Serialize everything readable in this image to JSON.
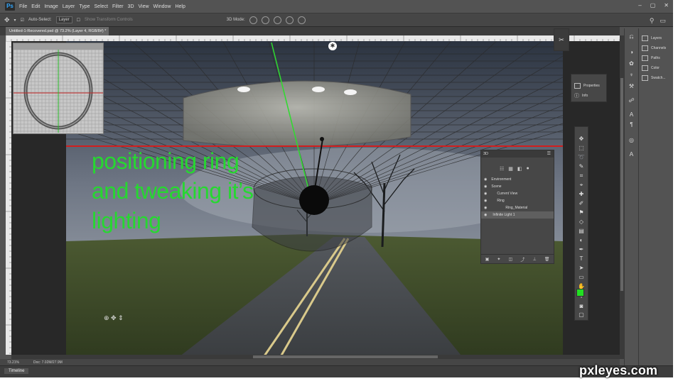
{
  "app": {
    "logo": "Ps"
  },
  "menu": [
    "File",
    "Edit",
    "Image",
    "Layer",
    "Type",
    "Select",
    "Filter",
    "3D",
    "View",
    "Window",
    "Help"
  ],
  "window_controls": {
    "minimize": "–",
    "restore": "▢",
    "close": "✕"
  },
  "options_bar": {
    "move_icon": "✥",
    "auto_select_label": "Auto-Select:",
    "auto_select_target": "Layer",
    "show_transform": "Show Transform Controls",
    "mode_label": "3D Mode:",
    "search_icon": "⚲",
    "workspace_icon": "▭"
  },
  "document": {
    "tab_title": "Untitled-1-Recovered.psd @ 73.2% (Layer 4, RGB/8#) *",
    "close": "×"
  },
  "canvas_caption": [
    "positioning ring",
    "and tweaking it’s",
    "lighting"
  ],
  "status": {
    "zoom": "73.21%",
    "doc_size": "Doc: 7.02M/27.9M"
  },
  "timeline": {
    "label": "Timeline"
  },
  "right_panels": {
    "items": [
      {
        "label": "Layers",
        "icon": "layers-icon"
      },
      {
        "label": "Channels",
        "icon": "channels-icon"
      },
      {
        "label": "Paths",
        "icon": "paths-icon"
      },
      {
        "label": "Color",
        "icon": "color-icon"
      },
      {
        "label": "Swatch...",
        "icon": "swatches-icon"
      }
    ]
  },
  "properties_panel": {
    "items": [
      {
        "label": "Properties"
      },
      {
        "label": "Info"
      }
    ]
  },
  "panel_3d": {
    "title": "3D",
    "rows": [
      {
        "label": "Environment",
        "indent": 0
      },
      {
        "label": "Scene",
        "indent": 0
      },
      {
        "label": "Current View",
        "indent": 1
      },
      {
        "label": "Ring",
        "indent": 1
      },
      {
        "label": "Ring_Material",
        "indent": 2
      },
      {
        "label": "Infinite Light 1",
        "indent": 1,
        "selected": true
      }
    ]
  },
  "foreground_color": "#22e022",
  "watermark": "pxleyes.com"
}
